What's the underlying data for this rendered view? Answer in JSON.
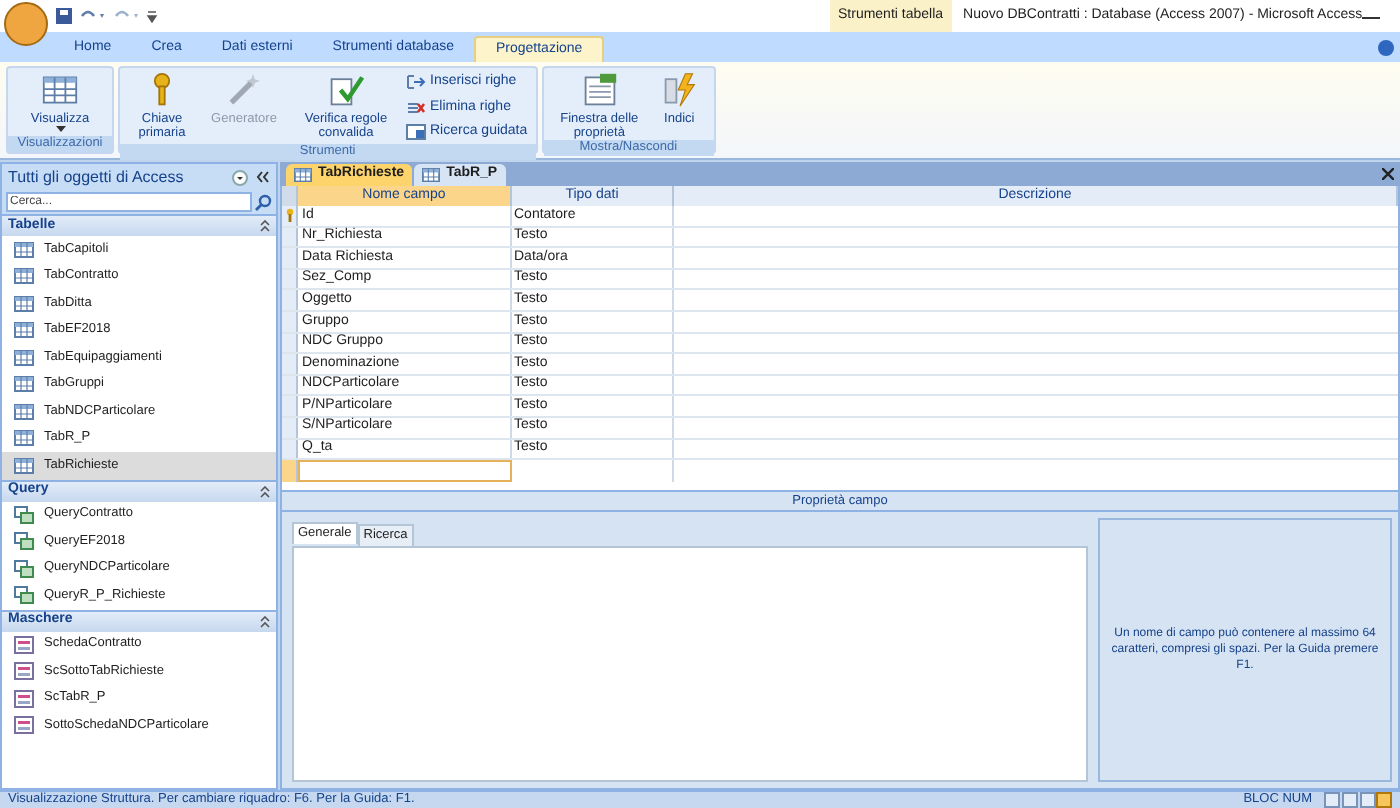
{
  "window": {
    "context_label": "Strumenti tabella",
    "title": "Nuovo DBContratti : Database (Access 2007) - Microsoft Access"
  },
  "ribbon_tabs": [
    {
      "label": "Home",
      "selected": false
    },
    {
      "label": "Crea",
      "selected": false
    },
    {
      "label": "Dati esterni",
      "selected": false
    },
    {
      "label": "Strumenti database",
      "selected": false
    },
    {
      "label": "Progettazione",
      "selected": true
    }
  ],
  "ribbon_groups": [
    {
      "title": "Visualizzazioni",
      "buttons": [
        {
          "kind": "large",
          "label": "Visualizza",
          "dropdown": true,
          "disabled": false
        }
      ]
    },
    {
      "title": "Strumenti",
      "buttons": [
        {
          "kind": "large",
          "label": "Chiave primaria",
          "dropdown": false,
          "disabled": false
        },
        {
          "kind": "large",
          "label": "Generatore",
          "dropdown": false,
          "disabled": true
        },
        {
          "kind": "large",
          "label": "Verifica regole convalida",
          "dropdown": false,
          "disabled": false
        },
        {
          "kind": "stack",
          "items": [
            {
              "label": "Inserisci righe"
            },
            {
              "label": "Elimina righe"
            },
            {
              "label": "Ricerca guidata"
            }
          ]
        }
      ]
    },
    {
      "title": "Mostra/Nascondi",
      "buttons": [
        {
          "kind": "large",
          "label": "Finestra delle proprietà",
          "dropdown": false,
          "disabled": false
        },
        {
          "kind": "large",
          "label": "Indici",
          "dropdown": false,
          "disabled": false
        }
      ]
    }
  ],
  "nav_pane": {
    "title": "Tutti gli oggetti di Access",
    "search": {
      "placeholder": "Cerca..."
    },
    "sections": [
      {
        "title": "Tabelle",
        "kind": "table",
        "items": [
          {
            "label": "TabCapitoli",
            "selected": false
          },
          {
            "label": "TabContratto",
            "selected": false
          },
          {
            "label": "TabDitta",
            "selected": false
          },
          {
            "label": "TabEF2018",
            "selected": false
          },
          {
            "label": "TabEquipaggiamenti",
            "selected": false
          },
          {
            "label": "TabGruppi",
            "selected": false
          },
          {
            "label": "TabNDCParticolare",
            "selected": false
          },
          {
            "label": "TabR_P",
            "selected": false
          },
          {
            "label": "TabRichieste",
            "selected": true
          }
        ]
      },
      {
        "title": "Query",
        "kind": "query",
        "items": [
          {
            "label": "QueryContratto",
            "selected": false
          },
          {
            "label": "QueryEF2018",
            "selected": false
          },
          {
            "label": "QueryNDCParticolare",
            "selected": false
          },
          {
            "label": "QueryR_P_Richieste",
            "selected": false
          }
        ]
      },
      {
        "title": "Maschere",
        "kind": "form",
        "items": [
          {
            "label": "SchedaContratto",
            "selected": false
          },
          {
            "label": "ScSottoTabRichieste",
            "selected": false
          },
          {
            "label": "ScTabR_P",
            "selected": false
          },
          {
            "label": "SottoSchedaNDCParticolare",
            "selected": false
          }
        ]
      }
    ]
  },
  "doc_tabs": [
    {
      "label": "TabRichieste",
      "selected": true
    },
    {
      "label": "TabR_P",
      "selected": false
    }
  ],
  "table": {
    "columns": [
      "Nome campo",
      "Tipo dati",
      "Descrizione"
    ],
    "rows": [
      {
        "name": "Id",
        "type": "Contatore",
        "primary_key": true
      },
      {
        "name": "Nr_Richiesta",
        "type": "Testo",
        "primary_key": false
      },
      {
        "name": "Data Richiesta",
        "type": "Data/ora",
        "primary_key": false
      },
      {
        "name": "Sez_Comp",
        "type": "Testo",
        "primary_key": false
      },
      {
        "name": "Oggetto",
        "type": "Testo",
        "primary_key": false
      },
      {
        "name": "Gruppo",
        "type": "Testo",
        "primary_key": false
      },
      {
        "name": "NDC Gruppo",
        "type": "Testo",
        "primary_key": false
      },
      {
        "name": "Denominazione",
        "type": "Testo",
        "primary_key": false
      },
      {
        "name": "NDCParticolare",
        "type": "Testo",
        "primary_key": false
      },
      {
        "name": "P/NParticolare",
        "type": "Testo",
        "primary_key": false
      },
      {
        "name": "S/NParticolare",
        "type": "Testo",
        "primary_key": false
      },
      {
        "name": "Q_ta",
        "type": "Testo",
        "primary_key": false
      }
    ]
  },
  "field_properties": {
    "title": "Proprietà campo",
    "tabs": [
      {
        "label": "Generale",
        "selected": true
      },
      {
        "label": "Ricerca",
        "selected": false
      }
    ],
    "help": "Un nome di campo può contenere al massimo 64 caratteri, compresi gli spazi. Per la Guida premere F1."
  },
  "status_bar": {
    "text": "Visualizzazione Struttura. Per cambiare riquadro: F6. Per la Guida: F1.",
    "indicator": "BLOC NUM"
  }
}
